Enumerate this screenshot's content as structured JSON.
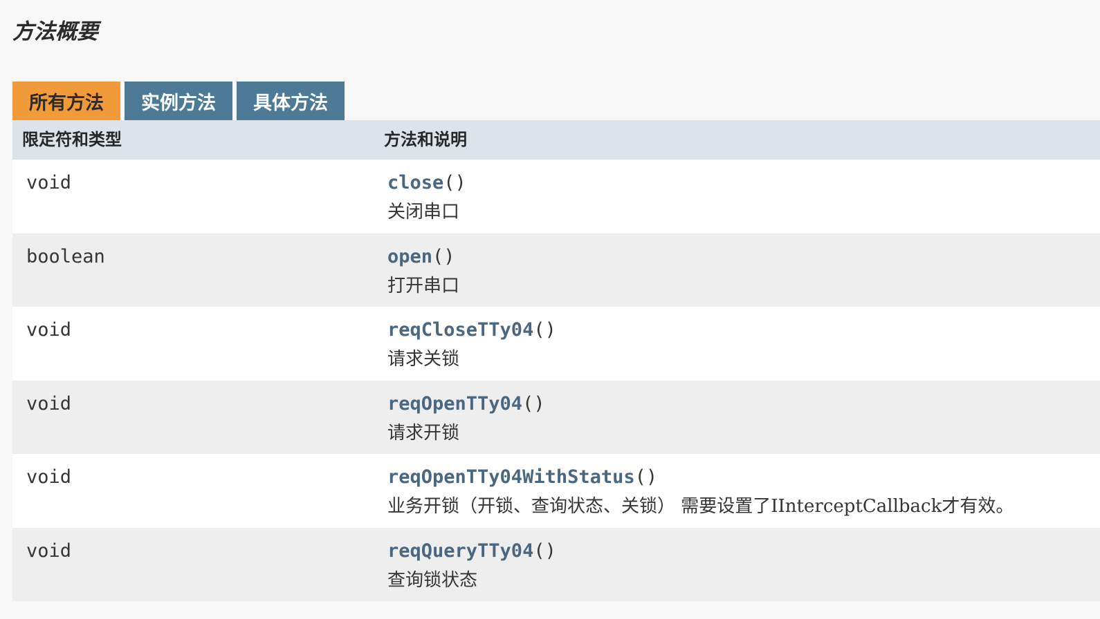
{
  "page": {
    "section_title": "方法概要"
  },
  "tabs": [
    {
      "label": "所有方法",
      "active": true
    },
    {
      "label": "实例方法",
      "active": false
    },
    {
      "label": "具体方法",
      "active": false
    }
  ],
  "table": {
    "headers": [
      "限定符和类型",
      "方法和说明"
    ],
    "rows": [
      {
        "type": "void",
        "method": "close",
        "parens": "()",
        "description": "关闭串口"
      },
      {
        "type": "boolean",
        "method": "open",
        "parens": "()",
        "description": "打开串口"
      },
      {
        "type": "void",
        "method": "reqCloseTTy04",
        "parens": "()",
        "description": "请求关锁"
      },
      {
        "type": "void",
        "method": "reqOpenTTy04",
        "parens": "()",
        "description": "请求开锁"
      },
      {
        "type": "void",
        "method": "reqOpenTTy04WithStatus",
        "parens": "()",
        "description": "业务开锁（开锁、查询状态、关锁） 需要设置了IInterceptCallback才有效。"
      },
      {
        "type": "void",
        "method": "reqQueryTTy04",
        "parens": "()",
        "description": "查询锁状态"
      }
    ]
  },
  "colors": {
    "tab_active": "#f19a3a",
    "tab_inactive": "#4d7a97",
    "header_bg": "#dee3e9",
    "row_alt_bg": "#eeeeef",
    "link": "#4a6782"
  }
}
